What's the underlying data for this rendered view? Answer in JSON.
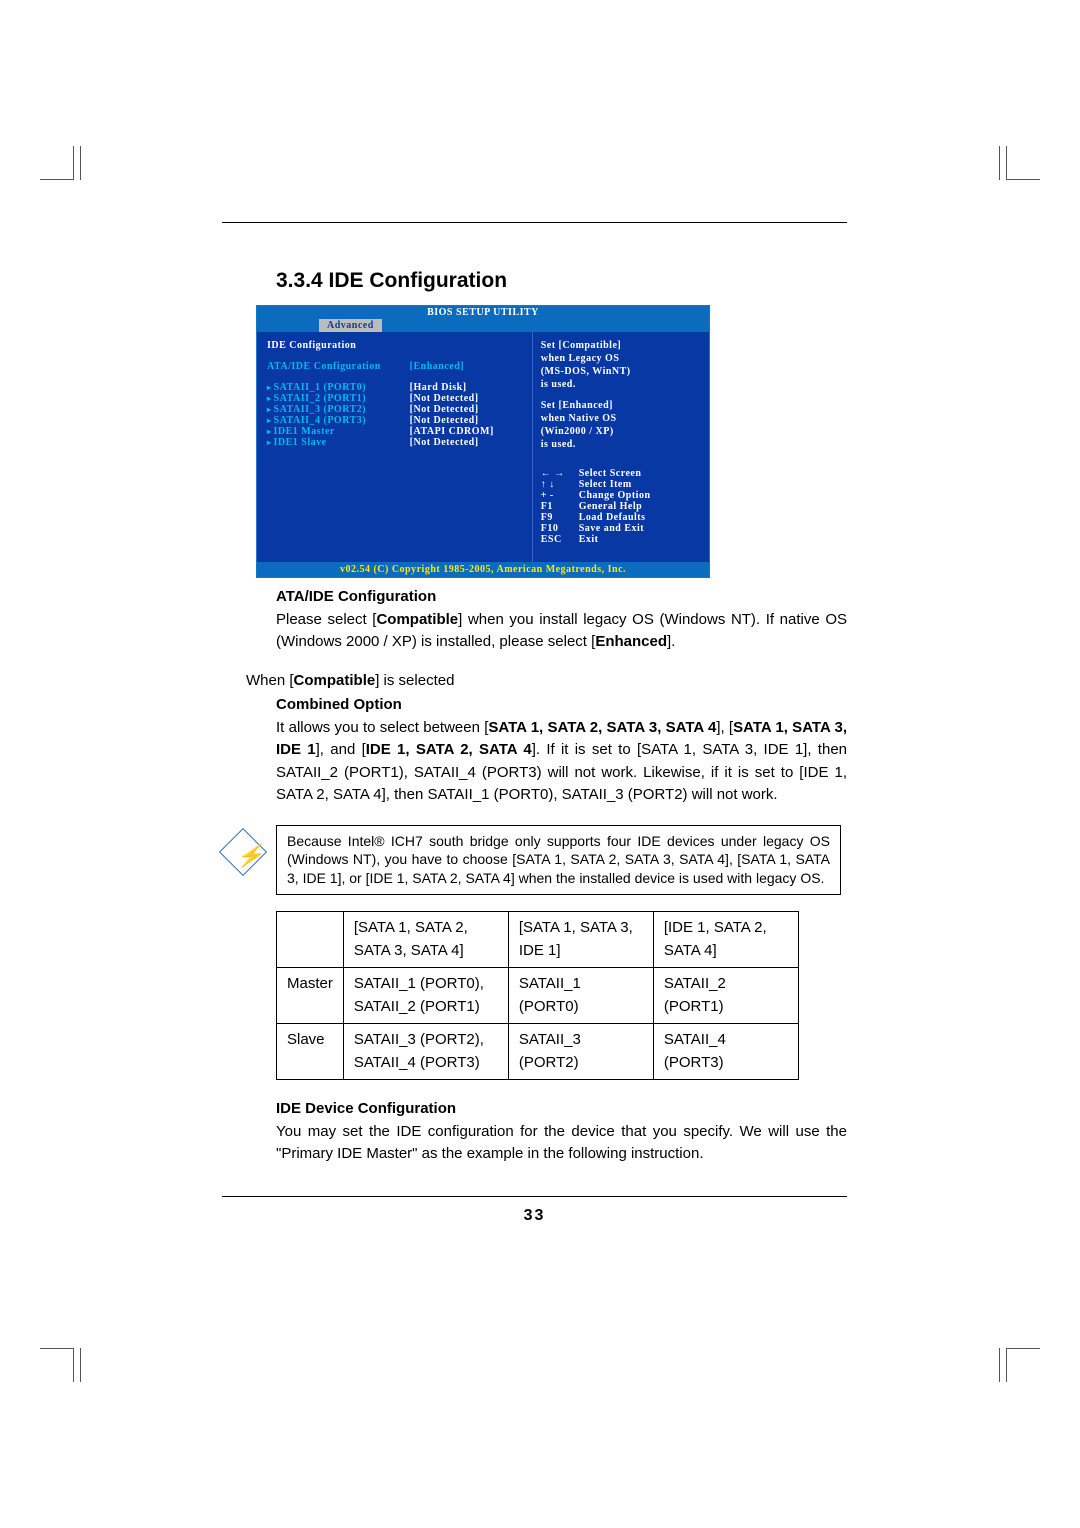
{
  "heading": "3.3.4 IDE Configuration",
  "bios": {
    "title": "BIOS SETUP UTILITY",
    "active_tab": "Advanced",
    "left_header": "IDE Configuration",
    "config_row": {
      "label": "ATA/IDE Configuration",
      "value": "[Enhanced]"
    },
    "devices": [
      {
        "label": "SATAII_1 (PORT0)",
        "value": "[Hard Disk]"
      },
      {
        "label": "SATAII_2 (PORT1)",
        "value": "[Not Detected]"
      },
      {
        "label": "SATAII_3 (PORT2)",
        "value": "[Not Detected]"
      },
      {
        "label": "SATAII_4 (PORT3)",
        "value": "[Not Detected]"
      },
      {
        "label": "IDE1 Master",
        "value": "[ATAPI CDROM]"
      },
      {
        "label": "IDE1 Slave",
        "value": "[Not Detected]"
      }
    ],
    "help_top": [
      "Set [Compatible]",
      "when Legacy OS",
      "(MS-DOS, WinNT)",
      "is used."
    ],
    "help_mid": [
      "Set [Enhanced]",
      "when Native OS",
      "(Win2000 / XP)",
      "is used."
    ],
    "keys": [
      {
        "k": "← →",
        "d": "Select Screen"
      },
      {
        "k": "↑ ↓",
        "d": "Select Item"
      },
      {
        "k": "+ -",
        "d": "Change Option"
      },
      {
        "k": "F1",
        "d": "General Help"
      },
      {
        "k": "F9",
        "d": "Load Defaults"
      },
      {
        "k": "F10",
        "d": "Save and Exit"
      },
      {
        "k": "ESC",
        "d": "Exit"
      }
    ],
    "footer": "v02.54 (C) Copyright 1985-2005, American Megatrends, Inc."
  },
  "sections": {
    "ata_head": "ATA/IDE Configuration",
    "ata_p1a": "Please select [",
    "ata_p1b": "Compatible",
    "ata_p1c": "] when you install legacy OS (Windows NT). If native OS (Windows 2000 / XP) is installed, please select [",
    "ata_p1d": "Enhanced",
    "ata_p1e": "].",
    "when_a": "When [",
    "when_b": "Compatible",
    "when_c": "] is selected",
    "combined_head": "Combined Option",
    "combined_a": "It allows you to select between [",
    "combined_b": "SATA 1, SATA 2, SATA 3, SATA 4",
    "combined_c": "], [",
    "combined_d": "SATA 1, SATA 3, IDE 1",
    "combined_e": "], and [",
    "combined_f": "IDE 1, SATA 2, SATA 4",
    "combined_g": "]. If it is set to [SATA 1, SATA 3, IDE 1], then SATAII_2 (PORT1), SATAII_4 (PORT3) will not work. Likewise, if it is set to [IDE 1, SATA 2, SATA 4], then SATAII_1 (PORT0), SATAII_3 (PORT2) will not work.",
    "note": "Because Intel® ICH7 south bridge only supports four IDE devices under legacy OS (Windows NT), you have to choose [SATA 1, SATA 2, SATA 3, SATA 4], [SATA 1, SATA 3, IDE 1], or [IDE 1, SATA 2, SATA 4] when the installed device is used with legacy OS.",
    "ide_dev_head": "IDE Device Configuration",
    "ide_dev_body": "You may set the IDE configuration for the device that you specify. We will use the \"Primary IDE Master\" as the example in the following instruction."
  },
  "table": {
    "headers": [
      "",
      "[SATA 1, SATA 2, SATA 3, SATA 4]",
      "[SATA 1, SATA 3, IDE 1]",
      "[IDE 1, SATA 2, SATA 4]"
    ],
    "rows": [
      {
        "label": "Master",
        "c1": "SATAII_1 (PORT0), SATAII_2 (PORT1)",
        "c2": "SATAII_1 (PORT0)",
        "c3": "SATAII_2 (PORT1)"
      },
      {
        "label": "Slave",
        "c1": "SATAII_3 (PORT2), SATAII_4 (PORT3)",
        "c2": "SATAII_3 (PORT2)",
        "c3": "SATAII_4 (PORT3)"
      }
    ]
  },
  "page_number": "33"
}
